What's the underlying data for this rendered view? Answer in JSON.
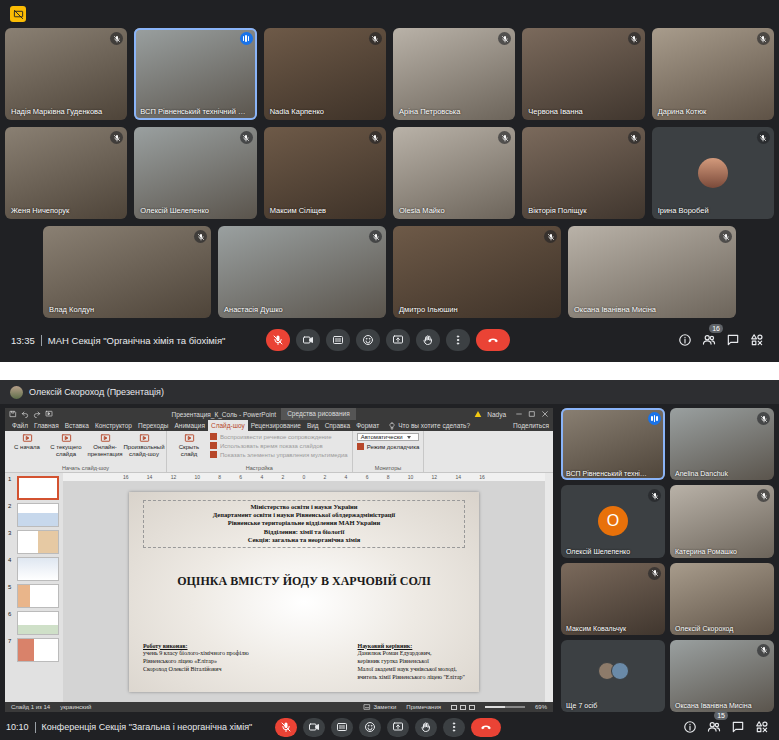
{
  "meeting_top": {
    "tile_rows": [
      [
        {
          "name": "Надія Марківна Гуденкова",
          "kind": "video",
          "muted": true,
          "speaking": false
        },
        {
          "name": "ВСП Рівненський технічний …",
          "kind": "video",
          "muted": false,
          "speaking": true
        },
        {
          "name": "Nadia Карпенко",
          "kind": "video",
          "muted": true,
          "speaking": false
        },
        {
          "name": "Аріна Петровська",
          "kind": "video",
          "muted": true,
          "speaking": false
        },
        {
          "name": "Червона Іванна",
          "kind": "video",
          "muted": true,
          "speaking": false
        },
        {
          "name": "Дарина Котюк",
          "kind": "video",
          "muted": true,
          "speaking": false
        }
      ],
      [
        {
          "name": "Женя Ничепорук",
          "kind": "video",
          "muted": true,
          "speaking": false
        },
        {
          "name": "Олексій Шелепенко",
          "kind": "video",
          "muted": true,
          "speaking": false
        },
        {
          "name": "Максим Сіліщев",
          "kind": "video",
          "muted": true,
          "speaking": false
        },
        {
          "name": "Olesia Майко",
          "kind": "video",
          "muted": true,
          "speaking": false
        },
        {
          "name": "Вікторія Поліщук",
          "kind": "video",
          "muted": true,
          "speaking": false
        },
        {
          "name": "Ірина Воробей",
          "kind": "avatar",
          "muted": true,
          "speaking": false
        }
      ],
      [
        {
          "name": "Влад Колдун",
          "kind": "video",
          "muted": true,
          "speaking": false
        },
        {
          "name": "Анастасія Душко",
          "kind": "video",
          "muted": true,
          "speaking": false
        },
        {
          "name": "Дмитро Ільюшин",
          "kind": "video",
          "muted": true,
          "speaking": false
        },
        {
          "name": "Оксана Іванівна Мисіна",
          "kind": "video",
          "muted": true,
          "speaking": false
        }
      ]
    ],
    "time": "13:35",
    "title": "МАН Секція \"Органічна хімія та біохімія\"",
    "mic_muted": true,
    "participants_count": "16"
  },
  "meeting_bottom": {
    "presenter": "Олексій Скороход (Презентація)",
    "powerpoint": {
      "title": "Презентация_К_Соль - PowerPoint",
      "context_tab": "Средства рисования",
      "user": "Nadya",
      "tabs": [
        {
          "label": "Файл",
          "selected": false
        },
        {
          "label": "Главная",
          "selected": false
        },
        {
          "label": "Вставка",
          "selected": false
        },
        {
          "label": "Конструктор",
          "selected": false
        },
        {
          "label": "Переходы",
          "selected": false
        },
        {
          "label": "Анимация",
          "selected": false
        },
        {
          "label": "Слайд-шоу",
          "selected": true
        },
        {
          "label": "Рецензирование",
          "selected": false
        },
        {
          "label": "Вид",
          "selected": false
        },
        {
          "label": "Справка",
          "selected": false
        },
        {
          "label": "Формат",
          "selected": false
        }
      ],
      "tell_me": "Что вы хотите сделать?",
      "share": "Поделиться",
      "ribbon_groups": [
        {
          "label": "Начать слайд-шоу",
          "buttons": [
            {
              "label": "С начала",
              "disabled": false
            },
            {
              "label": "С текущего слайда",
              "disabled": false
            },
            {
              "label": "Онлайн-презентация",
              "disabled": false
            },
            {
              "label": "Произвольный слайд-шоу",
              "disabled": false
            }
          ],
          "checks": []
        },
        {
          "label": "Настройка",
          "buttons": [
            {
              "label": "Скрыть слайд",
              "disabled": false
            }
          ],
          "checks": [
            {
              "label": "Воспроизвести речевое сопровождение",
              "checked": true,
              "disabled": true
            },
            {
              "label": "Использовать время показа слайдов",
              "checked": true,
              "disabled": true
            },
            {
              "label": "Показать элементы управления мультимедиа",
              "checked": true,
              "disabled": true
            }
          ]
        },
        {
          "label": "Мониторы",
          "buttons": [],
          "dropdown": "Автоматически",
          "checks": [
            {
              "label": "Режим докладчика",
              "checked": true,
              "disabled": false
            }
          ]
        }
      ],
      "ruler": [
        "16",
        "14",
        "12",
        "10",
        "8",
        "6",
        "4",
        "2",
        "0",
        "2",
        "4",
        "6",
        "8",
        "10",
        "12",
        "14",
        "16"
      ],
      "thumbnails": [
        {
          "number": "1",
          "selected": true
        },
        {
          "number": "2",
          "selected": false
        },
        {
          "number": "3",
          "selected": false
        },
        {
          "number": "4",
          "selected": false
        },
        {
          "number": "5",
          "selected": false
        },
        {
          "number": "6",
          "selected": false
        },
        {
          "number": "7",
          "selected": false
        }
      ],
      "slide": {
        "header": [
          "Міністерство освіти і науки України",
          "Департамент освіти і науки Рівненської облдержадміністрації",
          "Рівненське територіальне відділення МАН України",
          "Відділення: хімії та біології",
          "Секція: загальна та неорганічна хімія"
        ],
        "title": "ОЦІНКА ВМІСТУ ЙОДУ В ХАРЧОВІЙ СОЛІ",
        "author": {
          "label": "Роботу виконав:",
          "lines": [
            "учень 9 класу біолого-хімічного профілю",
            "Рівненського ліцею «Елітар»",
            "Скороход Олексій Віталійович"
          ]
        },
        "advisor": {
          "label": "Науковий керівник:",
          "lines": [
            "Данилюк Роман Едуардович,",
            "керівник гуртка Рівненської",
            "Малої академії наук учнівської молоді,",
            "вчитель хімії Рівненського ліцею \"Елітар\""
          ]
        }
      },
      "status": {
        "slide": "Слайд 1 из 14",
        "language": "украинский",
        "notes": "Заметки",
        "comments": "Примечания",
        "zoom": "69%",
        "zoom_level": 0.5
      }
    },
    "tiles": [
      {
        "name": "ВСП Рівненський техні…",
        "kind": "video",
        "muted": false,
        "speaking": true
      },
      {
        "name": "Anelina Danchuk",
        "kind": "video",
        "muted": true,
        "speaking": false
      },
      {
        "name": "Олексій Шелепенко",
        "kind": "letter",
        "initial": "О",
        "muted": true,
        "speaking": false
      },
      {
        "name": "Катерина Ромашко",
        "kind": "video",
        "muted": true,
        "speaking": false
      },
      {
        "name": "Максим Ковальчук",
        "kind": "video",
        "muted": true,
        "speaking": false
      },
      {
        "name": "Олексій Скороход",
        "kind": "video",
        "muted": false,
        "speaking": false
      },
      {
        "name": "Ще 7 осіб",
        "kind": "group",
        "muted": false,
        "speaking": false
      },
      {
        "name": "Оксана Іванівна Мисіна",
        "kind": "video",
        "muted": true,
        "speaking": false
      }
    ],
    "time": "10:10",
    "title": "Конференція Секція \"Загальна і неорганічна хімія\"",
    "mic_muted": true,
    "participants_count": "15"
  }
}
